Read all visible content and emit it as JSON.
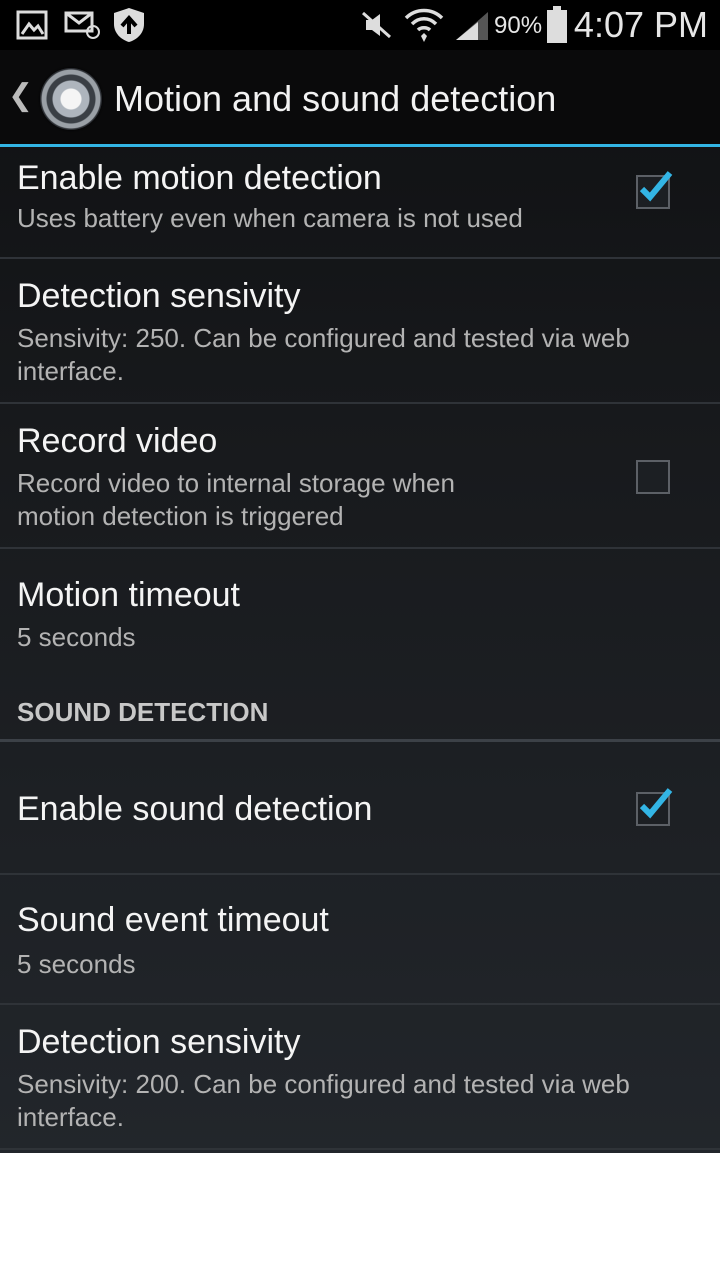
{
  "status_bar": {
    "battery_pct": "90%",
    "time": "4:07 PM",
    "icons": [
      "gallery-icon",
      "email-icon",
      "shield-icon",
      "mute-icon",
      "wifi-icon",
      "signal-icon",
      "battery-icon"
    ]
  },
  "action_bar": {
    "title": "Motion and sound detection",
    "back_icon": "chevron-left-icon",
    "logo_icon": "camera-lens-icon"
  },
  "prefs": [
    {
      "title": "Enable motion detection",
      "summary": "Uses battery even when camera is not used",
      "checked": true
    },
    {
      "title": "Detection sensivity",
      "summary": "Sensivity: 250. Can be configured and tested via web interface."
    },
    {
      "title": "Record video",
      "summary": "Record video to internal storage when motion detection is triggered",
      "checked": false
    },
    {
      "title": "Motion timeout",
      "summary": "5 seconds"
    }
  ],
  "sound_section": {
    "header": "SOUND DETECTION",
    "prefs": [
      {
        "title": "Enable sound detection",
        "checked": true
      },
      {
        "title": "Sound event timeout",
        "summary": "5 seconds"
      },
      {
        "title": "Detection sensivity",
        "summary": "Sensivity: 200. Can be configured and tested via web interface."
      }
    ]
  },
  "colors": {
    "accent": "#33b5e5",
    "background": "#181a1d"
  }
}
